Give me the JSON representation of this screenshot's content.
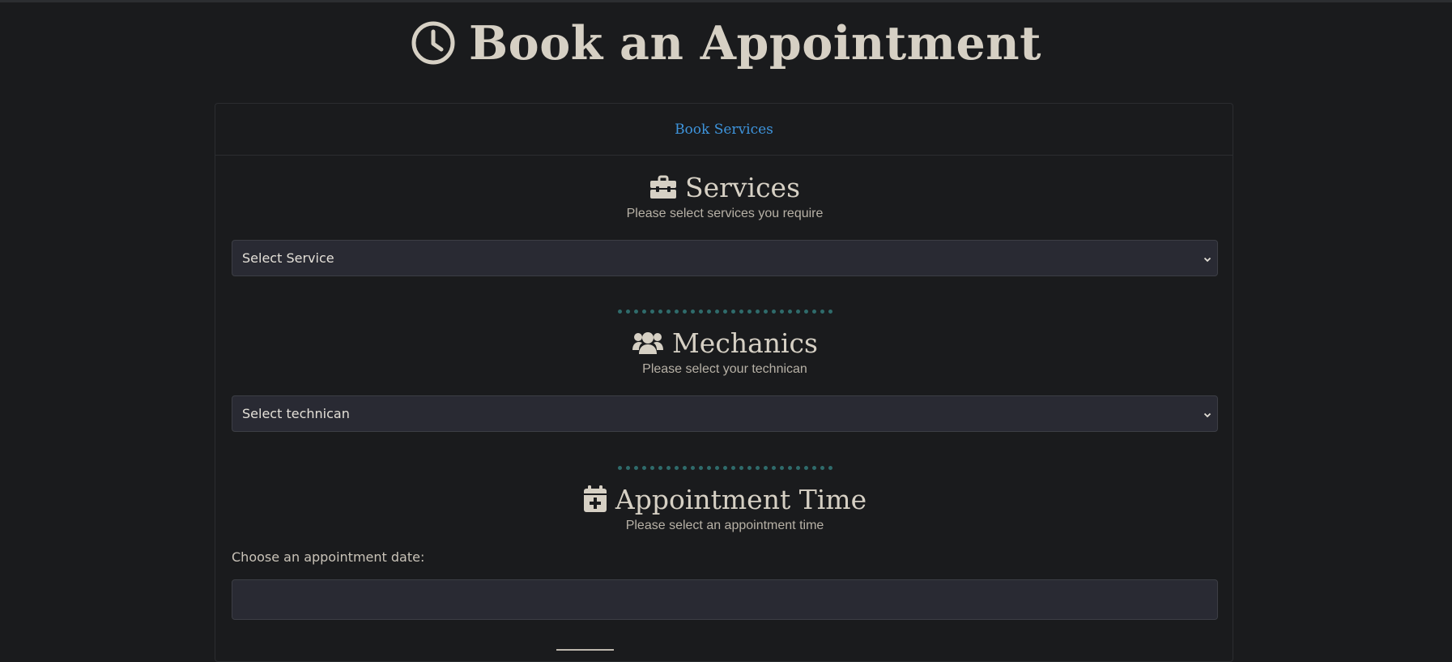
{
  "page": {
    "title": "Book an Appointment",
    "title_icon": "clock-icon"
  },
  "card": {
    "header_link": "Book Services"
  },
  "services": {
    "icon": "toolbox-icon",
    "heading": "Services",
    "subtitle": "Please select services you require",
    "select_value": "Select Service"
  },
  "mechanics": {
    "icon": "users-icon",
    "heading": "Mechanics",
    "subtitle": "Please select your technican",
    "select_value": "Select technican"
  },
  "appointment": {
    "icon": "calendar-plus-icon",
    "heading": "Appointment Time",
    "subtitle": "Please select an appointment time",
    "date_label": "Choose an appointment date:",
    "date_value": ""
  },
  "colors": {
    "background": "#1a1b1d",
    "link": "#3e94dc",
    "input_bg": "#292a33",
    "divider_dots": "#2f6b6b",
    "text": "#d6d0c4"
  }
}
